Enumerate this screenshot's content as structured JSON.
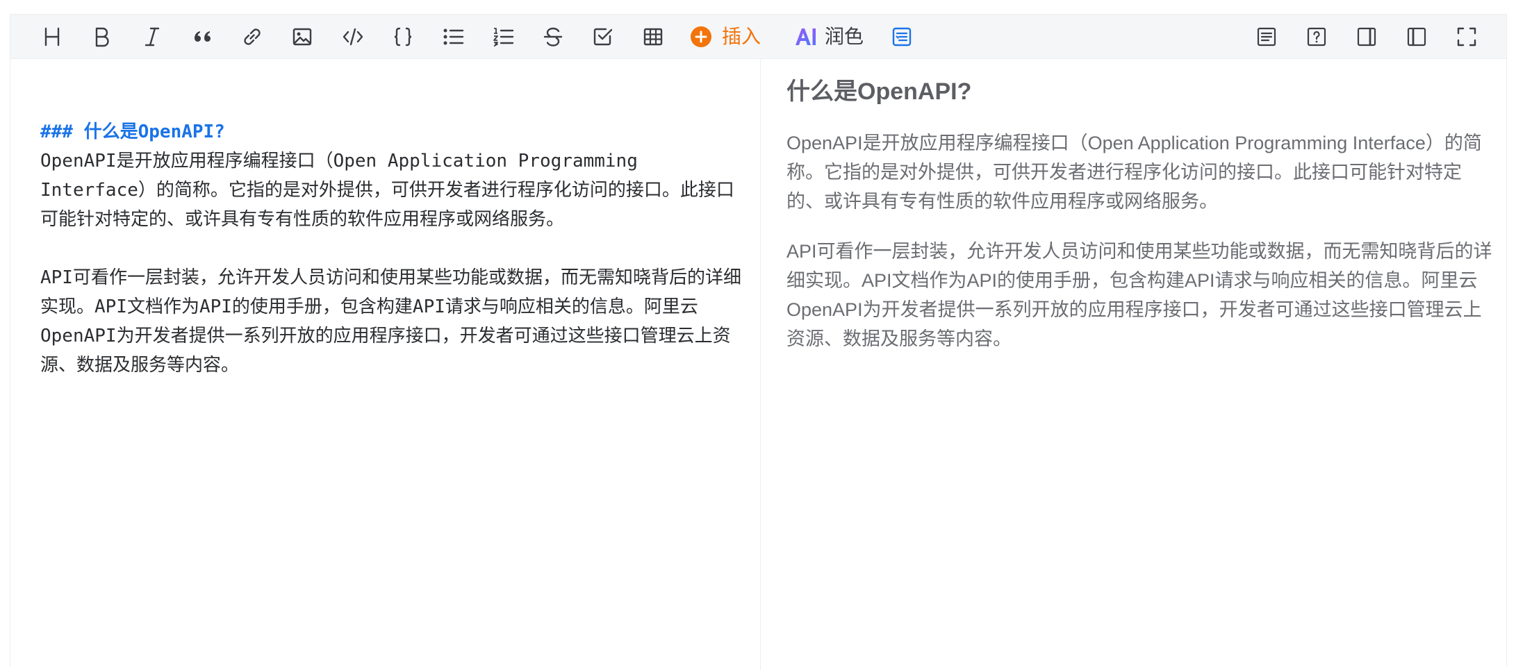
{
  "toolbar": {
    "left_tools": [
      {
        "name": "heading-icon"
      },
      {
        "name": "bold-icon"
      },
      {
        "name": "italic-icon"
      },
      {
        "name": "quote-icon"
      },
      {
        "name": "link-icon"
      },
      {
        "name": "image-icon"
      },
      {
        "name": "code-icon"
      },
      {
        "name": "code-block-icon"
      },
      {
        "name": "bullet-list-icon"
      },
      {
        "name": "ordered-list-icon"
      },
      {
        "name": "strikethrough-icon"
      },
      {
        "name": "checkbox-icon"
      },
      {
        "name": "table-icon"
      }
    ],
    "insert_label": "插入",
    "polish_icon_text": "AI",
    "polish_label": "润色",
    "right_tools": [
      {
        "name": "outline-icon"
      },
      {
        "name": "help-icon"
      },
      {
        "name": "toggle-preview-icon"
      },
      {
        "name": "toggle-sidebar-icon"
      },
      {
        "name": "fullscreen-icon"
      }
    ],
    "colors": {
      "insert_accent": "#f2740b",
      "ai_gradient_start": "#a452f5",
      "ai_gradient_end": "#4b7bff",
      "active_blue": "#1a73e8"
    }
  },
  "editor": {
    "heading_markdown": "### 什么是OpenAPI?",
    "paragraph1": "OpenAPI是开放应用程序编程接口（Open Application Programming Interface）的简称。它指的是对外提供，可供开发者进行程序化访问的接口。此接口可能针对特定的、或许具有专有性质的软件应用程序或网络服务。",
    "paragraph2": "API可看作一层封装，允许开发人员访问和使用某些功能或数据，而无需知晓背后的详细实现。API文档作为API的使用手册，包含构建API请求与响应相关的信息。阿里云OpenAPI为开发者提供一系列开放的应用程序接口，开发者可通过这些接口管理云上资源、数据及服务等内容。"
  },
  "preview": {
    "heading": "什么是OpenAPI?",
    "paragraph1": "OpenAPI是开放应用程序编程接口（Open Application Programming Interface）的简称。它指的是对外提供，可供开发者进行程序化访问的接口。此接口可能针对特定的、或许具有专有性质的软件应用程序或网络服务。",
    "paragraph2": "API可看作一层封装，允许开发人员访问和使用某些功能或数据，而无需知晓背后的详细实现。API文档作为API的使用手册，包含构建API请求与响应相关的信息。阿里云OpenAPI为开发者提供一系列开放的应用程序接口，开发者可通过这些接口管理云上资源、数据及服务等内容。"
  }
}
